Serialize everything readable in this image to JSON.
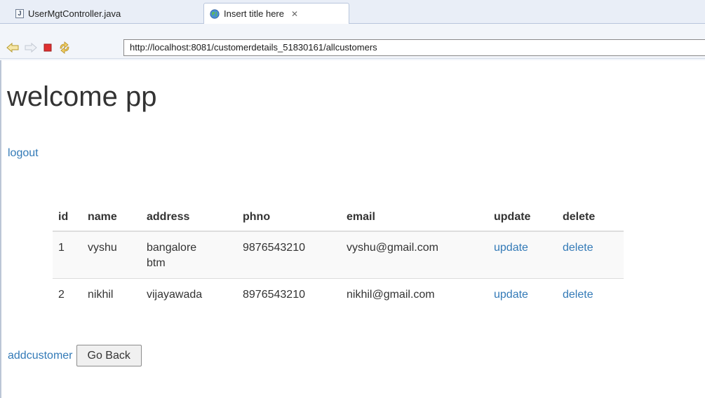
{
  "tabs": [
    {
      "label": "UserMgtController.java",
      "active": false
    },
    {
      "label": "Insert title here",
      "active": true
    }
  ],
  "tab_close_glyph": "✕",
  "toolbar": {
    "url": "http://localhost:8081/customerdetails_51830161/allcustomers",
    "icons": [
      "back-arrow-icon",
      "forward-arrow-icon",
      "stop-icon",
      "refresh-icon"
    ]
  },
  "page": {
    "heading": "welcome pp",
    "logout_label": "logout",
    "table": {
      "headers": [
        "id",
        "name",
        "address",
        "phno",
        "email",
        "update",
        "delete"
      ],
      "rows": [
        {
          "id": "1",
          "name": "vyshu",
          "address_line1": "bangalore",
          "address_line2": "btm",
          "phno": "9876543210",
          "email": "vyshu@gmail.com",
          "update": "update",
          "delete": "delete"
        },
        {
          "id": "2",
          "name": "nikhil",
          "address_line1": "vijayawada",
          "address_line2": "",
          "phno": "8976543210",
          "email": "nikhil@gmail.com",
          "update": "update",
          "delete": "delete"
        }
      ]
    },
    "addcustomer_label": "addcustomer",
    "go_back_label": "Go Back"
  },
  "colors": {
    "link": "#337ab7",
    "text": "#333333",
    "stop_red": "#e03030",
    "arrow_yellow": "#e9c84a"
  }
}
